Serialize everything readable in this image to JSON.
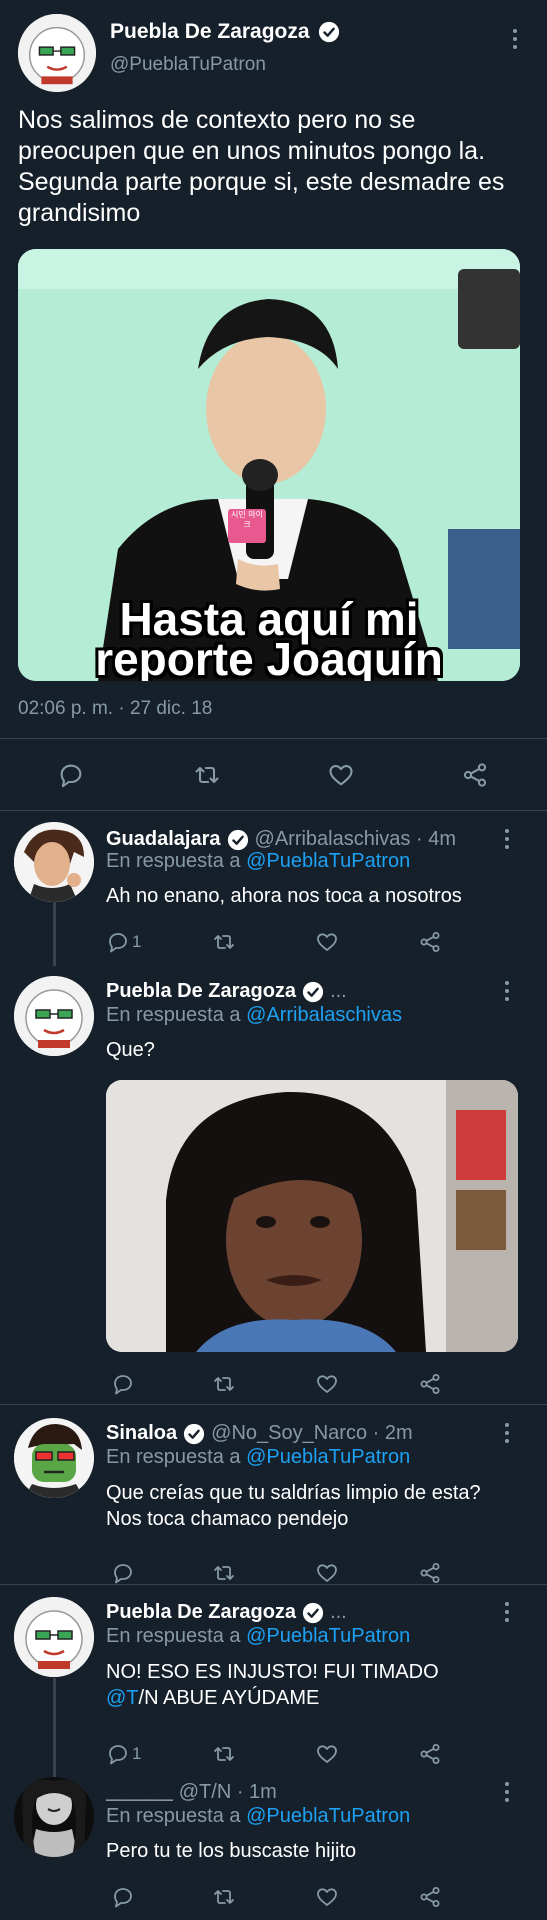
{
  "main_tweet": {
    "display_name": "Puebla De Zaragoza",
    "handle": "@PueblaTuPatron",
    "text": "Nos salimos de contexto pero no se preocupen que en unos minutos pongo la. Segunda parte porque si, este desmadre es grandisimo",
    "image_caption_line1": "Hasta aquí mi",
    "image_caption_line2": "reporte Joaquín",
    "image_badge": "시민 마이크",
    "timestamp": "02:06 p. m. · 27 dic. 18"
  },
  "replies": [
    {
      "display_name": "Guadalajara",
      "handle_time": "@Arribalaschivas · 4m",
      "reply_prefix": "En respuesta a",
      "reply_to": "@PueblaTuPatron",
      "text": "Ah no enano, ahora nos toca a nosotros",
      "reply_count": "1"
    },
    {
      "display_name": "Puebla De Zaragoza",
      "handle_time": "...",
      "reply_prefix": "En respuesta a",
      "reply_to": "@Arribalaschivas",
      "text": "Que?"
    },
    {
      "display_name": "Sinaloa",
      "handle_time": "@No_Soy_Narco · 2m",
      "reply_prefix": "En respuesta a",
      "reply_to": "@PueblaTuPatron",
      "text_line1": "Que creías que tu saldrías limpio de esta?",
      "text_line2": "Nos toca chamaco pendejo"
    },
    {
      "display_name": "Puebla De Zaragoza",
      "handle_time": "...",
      "reply_prefix": "En respuesta a",
      "reply_to": "@PueblaTuPatron",
      "text_line1": "NO! ESO ES INJUSTO! FUI TIMADO",
      "text_mention": "@T",
      "text_line2_rest": "/N ABUE AYÚDAME",
      "reply_count": "1"
    },
    {
      "display_name": "______",
      "handle_time": "@T/N · 1m",
      "reply_prefix": "En respuesta a",
      "reply_to": "@PueblaTuPatron",
      "text": "Pero tu te los  buscaste hijito"
    }
  ],
  "colors": {
    "background": "#15202b",
    "secondary_text": "#8899a6",
    "accent": "#1da1f2",
    "divider": "#38444d"
  },
  "icons": [
    "verified-badge-icon",
    "more-options-icon",
    "reply-icon",
    "retweet-icon",
    "like-icon",
    "share-icon"
  ]
}
